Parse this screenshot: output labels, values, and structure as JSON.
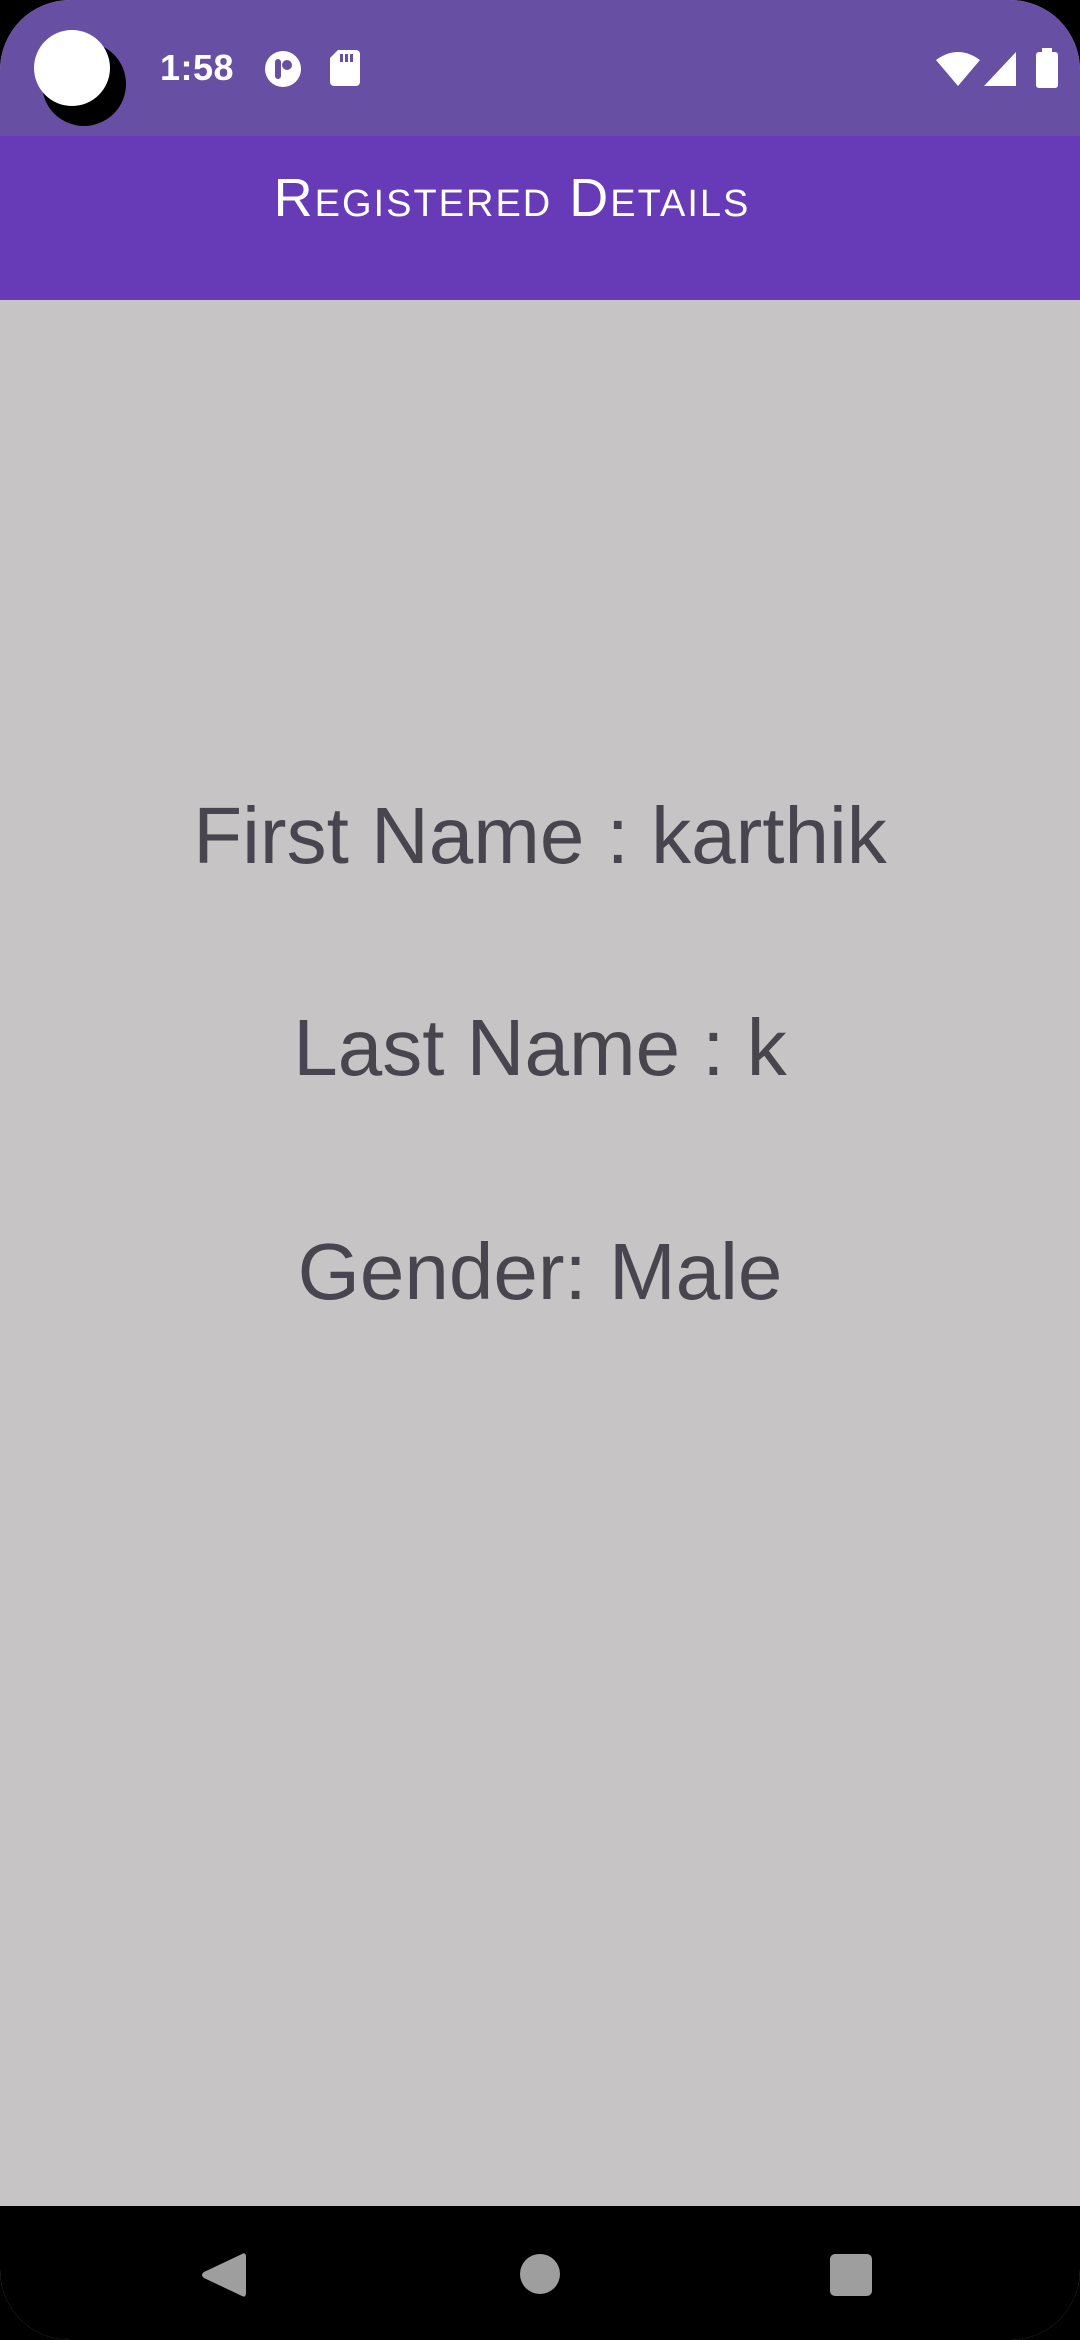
{
  "status_bar": {
    "time": "1:58",
    "icons": [
      "app-notification-icon",
      "sd-card-icon",
      "wifi-icon",
      "signal-icon",
      "battery-icon"
    ]
  },
  "app_bar": {
    "title": "Registered Details"
  },
  "details": {
    "first_name": "First Name : karthik",
    "last_name": "Last Name : k",
    "gender": "Gender: Male"
  },
  "nav_bar": {
    "icons": [
      "back-icon",
      "home-icon",
      "recents-icon"
    ]
  },
  "colors": {
    "status_bar": "#6750a4",
    "app_bar": "#673ab7",
    "background": "#c6c4c5",
    "text": "#48454e"
  }
}
